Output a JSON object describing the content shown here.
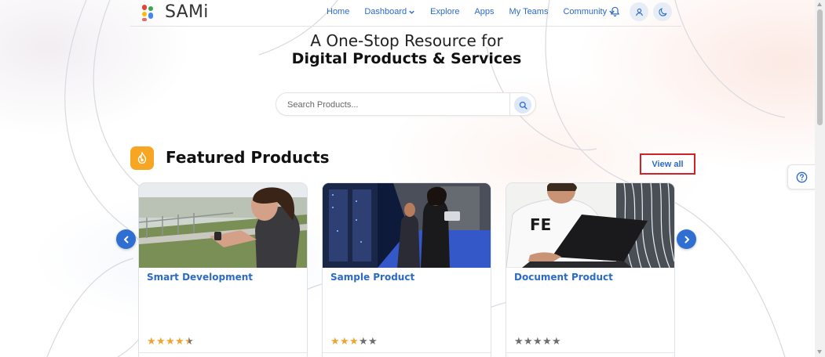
{
  "brand": {
    "name": "SAMi"
  },
  "nav": {
    "links": [
      {
        "label": "Home",
        "dropdown": false
      },
      {
        "label": "Dashboard",
        "dropdown": true
      },
      {
        "label": "Explore",
        "dropdown": false
      },
      {
        "label": "Apps",
        "dropdown": false
      },
      {
        "label": "My Teams",
        "dropdown": false
      },
      {
        "label": "Community",
        "dropdown": true
      }
    ],
    "icons": [
      "bell-icon",
      "user-icon",
      "moon-icon"
    ]
  },
  "hero": {
    "line1": "A One-Stop Resource for",
    "line2": "Digital Products & Services"
  },
  "search": {
    "placeholder": "Search Products...",
    "value": "",
    "icon": "search-icon"
  },
  "featured": {
    "title": "Featured Products",
    "icon": "flame-icon",
    "view_all_label": "View all",
    "products": [
      {
        "title": "Smart Development",
        "rating": 4.5,
        "image": "woman-checking-smartwatch-photo"
      },
      {
        "title": "Sample Product",
        "rating": 3,
        "image": "server-room-people-photo"
      },
      {
        "title": "Document Product",
        "rating": 0,
        "image": "man-with-laptop-photo"
      }
    ]
  },
  "carousel": {
    "prev_icon": "chevron-left-icon",
    "next_icon": "chevron-right-icon"
  },
  "help": {
    "icon": "question-circle-icon"
  },
  "colors": {
    "link_blue": "#2b6ac8",
    "accent_orange": "#f6a623",
    "star_filled": "#f0a431",
    "star_empty": "#6e6e6e",
    "highlight_red": "#d32029",
    "arrow_blue": "#2f6fd1"
  }
}
